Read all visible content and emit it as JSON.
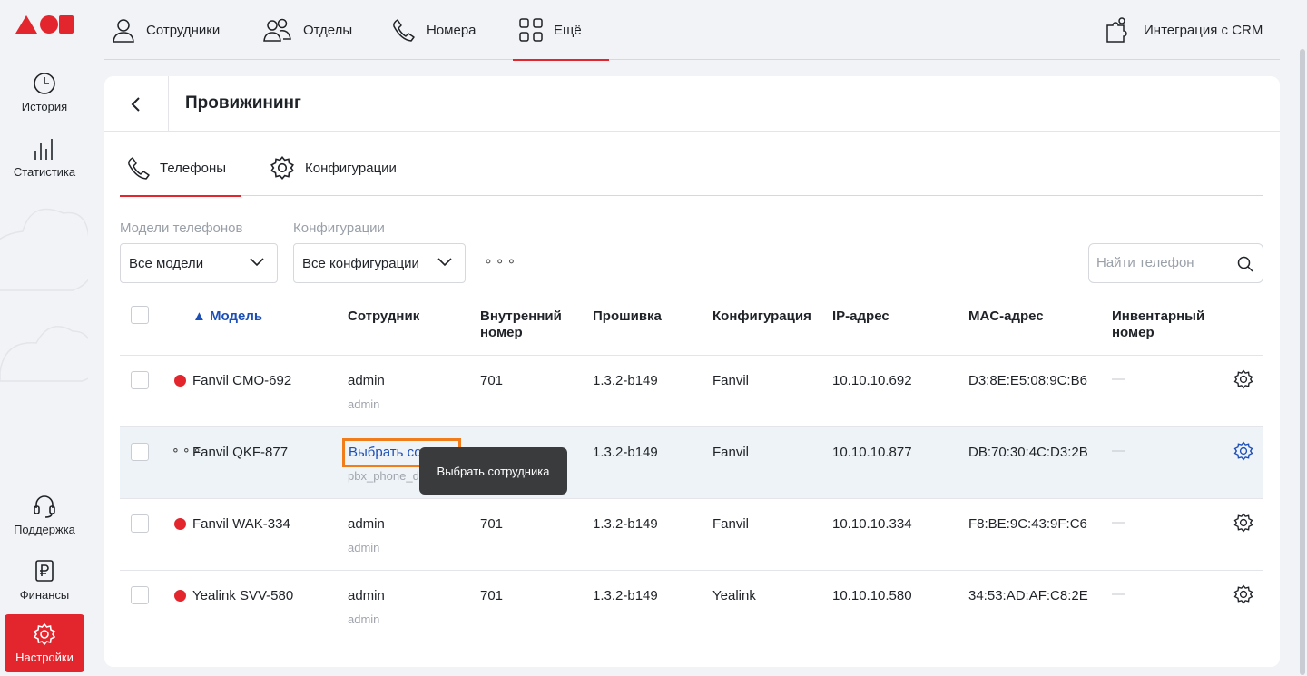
{
  "colors": {
    "accent": "#e3262e",
    "link": "#1d4fb8",
    "highlight": "#f07d19"
  },
  "sidebar": {
    "items": [
      {
        "label": "История",
        "icon": "clock-icon"
      },
      {
        "label": "Статистика",
        "icon": "bar-chart-icon"
      },
      {
        "label": "Поддержка",
        "icon": "headset-icon"
      },
      {
        "label": "Финансы",
        "icon": "ruble-icon"
      },
      {
        "label": "Настройки",
        "icon": "gear-icon",
        "active": true
      }
    ]
  },
  "topnav": {
    "items": [
      {
        "label": "Сотрудники",
        "icon": "user-icon"
      },
      {
        "label": "Отделы",
        "icon": "users-icon"
      },
      {
        "label": "Номера",
        "icon": "phone-icon"
      },
      {
        "label": "Ещё",
        "icon": "grid-icon",
        "active": true
      }
    ],
    "crm_label": "Интеграция с CRM"
  },
  "page": {
    "title": "Провижининг"
  },
  "tabs": [
    {
      "label": "Телефоны",
      "icon": "phone-icon",
      "active": true
    },
    {
      "label": "Конфигурации",
      "icon": "gear-icon"
    }
  ],
  "filters": {
    "models_label": "Модели телефонов",
    "models_value": "Все модели",
    "configs_label": "Конфигурации",
    "configs_value": "Все конфигурации",
    "more": "⚬⚬⚬",
    "search_placeholder": "Найти телефон"
  },
  "table": {
    "sort_arrow": "▲",
    "headers": {
      "model": "Модель",
      "employee": "Сотрудник",
      "ext": "Внутренний номер",
      "firmware": "Прошивка",
      "config": "Конфигурация",
      "ip": "IP-адрес",
      "mac": "MAC-адрес",
      "inventory": "Инвентарный номер"
    },
    "rows": [
      {
        "model": "Fanvil CMO-692",
        "employee": "admin",
        "employee_sub": "admin",
        "ext": "701",
        "firmware": "1.3.2-b149",
        "config": "Fanvil",
        "ip": "10.10.10.692",
        "mac": "D3:8E:E5:08:9C:B6",
        "inventory": "—"
      },
      {
        "model": "Fanvil QKF-877",
        "employee": "Выбрать сотр...",
        "employee_sub": "pbx_phone_d",
        "ext": "",
        "firmware": "1.3.2-b149",
        "config": "Fanvil",
        "ip": "10.10.10.877",
        "mac": "DB:70:30:4C:D3:2B",
        "inventory": "—",
        "more": "⚬⚬⚬"
      },
      {
        "model": "Fanvil WAK-334",
        "employee": "admin",
        "employee_sub": "admin",
        "ext": "701",
        "firmware": "1.3.2-b149",
        "config": "Fanvil",
        "ip": "10.10.10.334",
        "mac": "F8:BE:9C:43:9F:C6",
        "inventory": "—"
      },
      {
        "model": "Yealink SVV-580",
        "employee": "admin",
        "employee_sub": "admin",
        "ext": "701",
        "firmware": "1.3.2-b149",
        "config": "Yealink",
        "ip": "10.10.10.580",
        "mac": "34:53:AD:AF:C8:2E",
        "inventory": "—"
      }
    ]
  },
  "tooltip": "Выбрать сотрудника"
}
